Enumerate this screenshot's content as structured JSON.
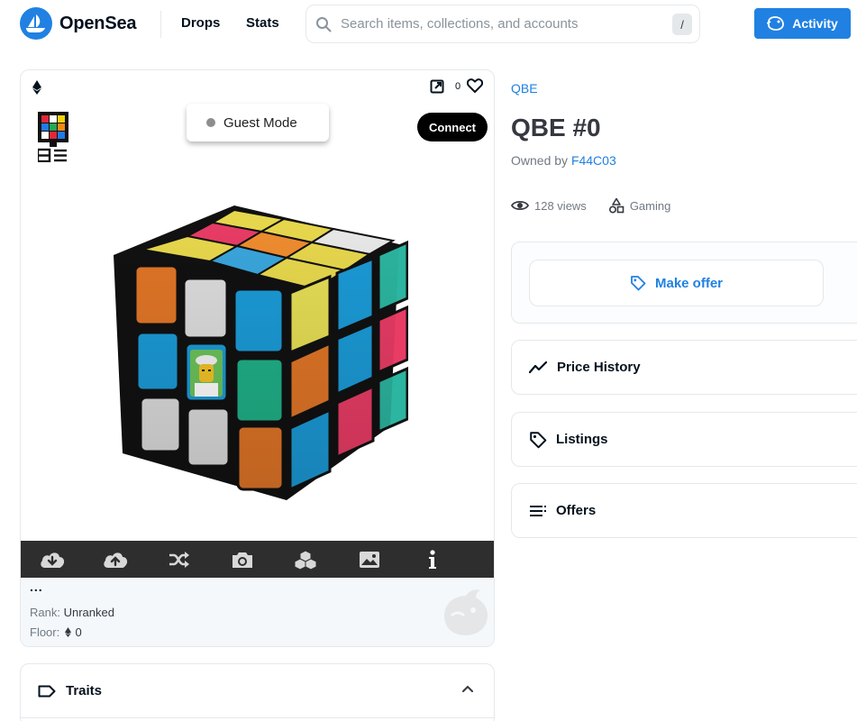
{
  "header": {
    "brand": "OpenSea",
    "nav": [
      {
        "label": "Drops"
      },
      {
        "label": "Stats"
      }
    ],
    "search": {
      "placeholder": "Search items, collections, and accounts",
      "shortcut": "/"
    },
    "activity_label": "Activity"
  },
  "media": {
    "favorites_count": "0",
    "guest_mode_label": "Guest Mode",
    "connect_label": "Connect",
    "toolbar_icons": [
      "download-icon",
      "upload-icon",
      "shuffle-icon",
      "camera-icon",
      "cubes-icon",
      "image-icon",
      "info-icon"
    ],
    "more_label": "...",
    "rank_label": "Rank:",
    "rank_value": "Unranked",
    "floor_label": "Floor:",
    "floor_value": "0"
  },
  "traits": {
    "label": "Traits"
  },
  "item": {
    "collection": "QBE",
    "title": "QBE #0",
    "owned_by_label": "Owned by",
    "owner": "F44C03",
    "views": "128 views",
    "category": "Gaming"
  },
  "actions": {
    "make_offer_label": "Make offer"
  },
  "panels": {
    "price_history": "Price History",
    "listings": "Listings",
    "offers": "Offers"
  },
  "colors": {
    "accent": "#2081e2",
    "text_dark": "#04111d",
    "toolbar_bg": "#2e2e2e"
  }
}
